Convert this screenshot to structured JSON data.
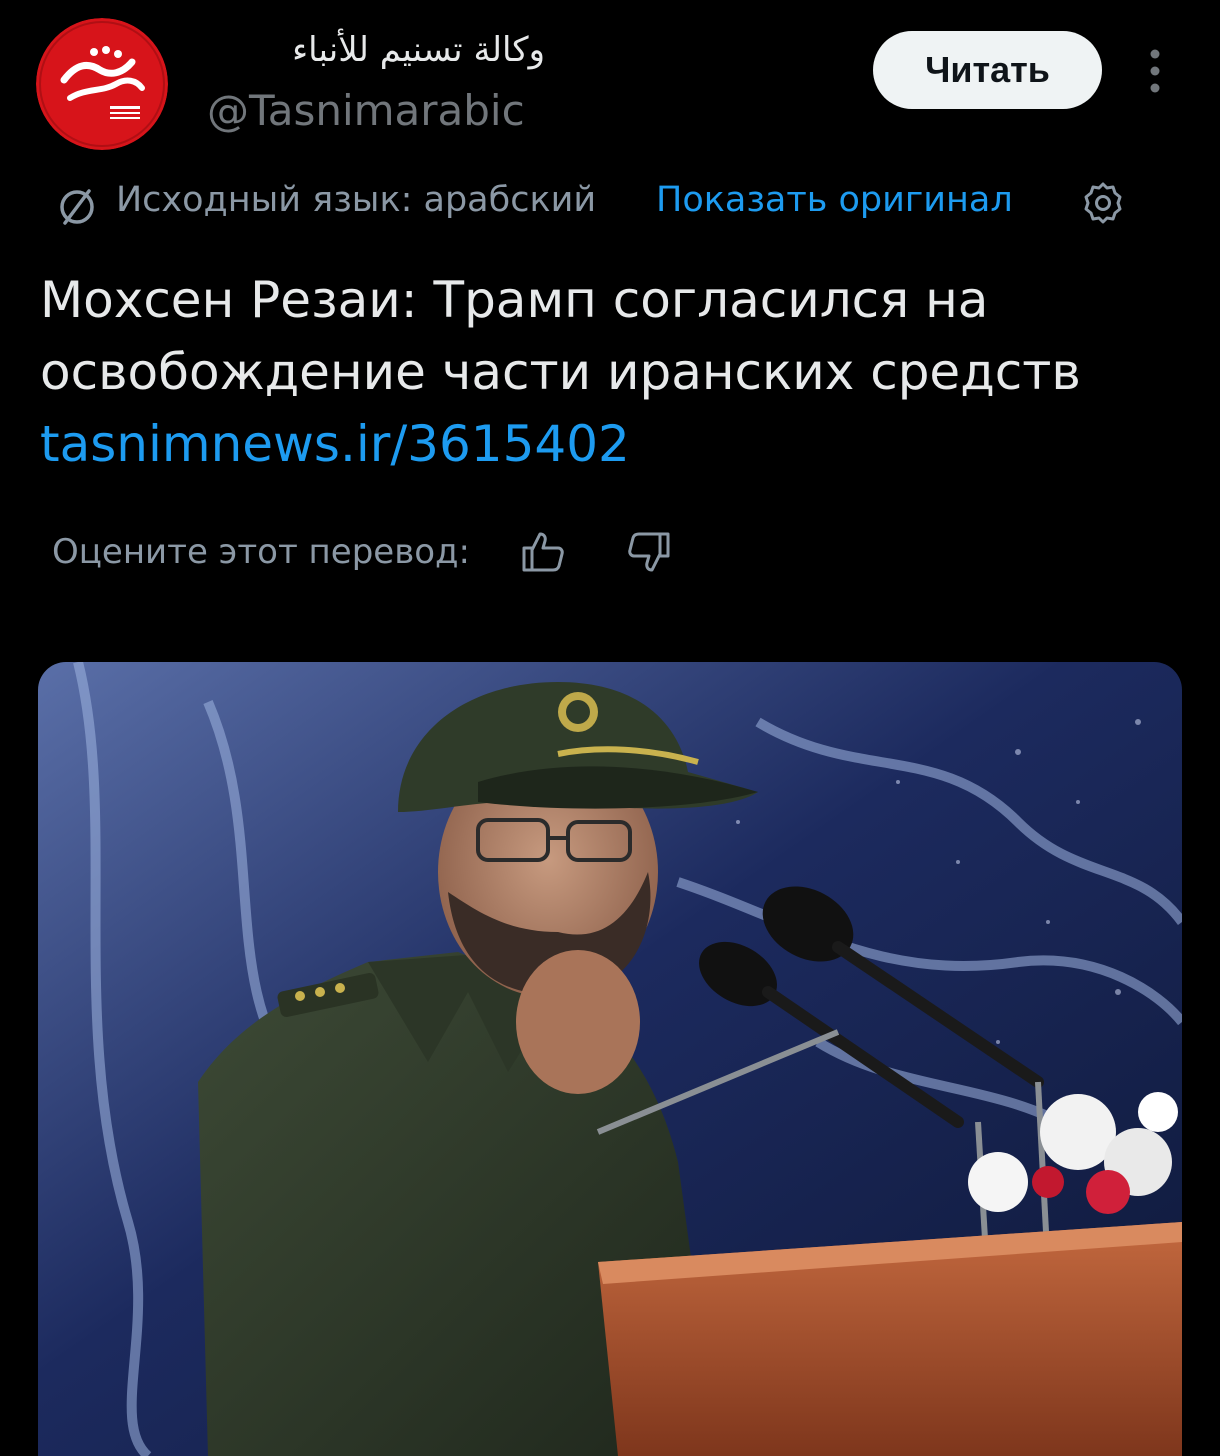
{
  "account": {
    "name": "وكالة تسنيم للأنباء",
    "handle": "@Tasnimarabic",
    "avatar_icon": "tasnim-logo",
    "avatar_color": "#d7141a"
  },
  "header": {
    "follow_label": "Читать",
    "more_icon": "vertical-dots-icon"
  },
  "translation": {
    "source_text": "Исходный язык: арабский",
    "show_original_label": "Показать оригинал",
    "link_color": "#1d9bf0"
  },
  "tweet": {
    "line1": "Мохсен Резаи: Трамп согласился на",
    "line2": "освобождение части иранских средств",
    "link": "tasnimnews.ir/3615402"
  },
  "rating": {
    "label": "Оцените этот перевод:"
  },
  "media": {
    "type": "photo"
  }
}
